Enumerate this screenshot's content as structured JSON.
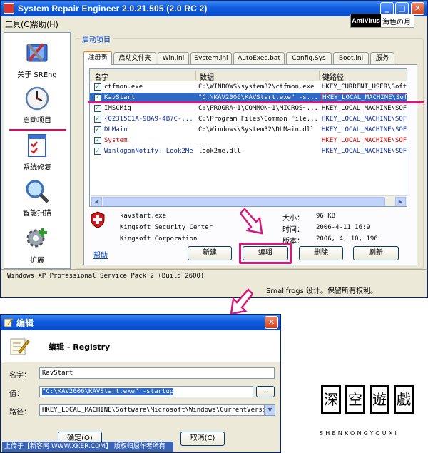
{
  "main_window": {
    "title": "System Repair Engineer 2.0.21.505 (2.0 RC 2)",
    "menu": [
      "工具(C)",
      "帮助(H)"
    ],
    "watermark": {
      "badge": "AntiVirus",
      "text": "海色の月"
    },
    "sidebar": [
      {
        "label": "关于 SREng",
        "icon": "tools-icon"
      },
      {
        "label": "启动项目",
        "icon": "clock-icon"
      },
      {
        "label": "系统修复",
        "icon": "checklist-icon"
      },
      {
        "label": "智能扫描",
        "icon": "magnifier-icon"
      },
      {
        "label": "扩展",
        "icon": "gear-plus-icon"
      }
    ],
    "group_title": "启动项目",
    "tabs": [
      "注册表",
      "启动文件夹",
      "Win.ini",
      "System.ini",
      "AutoExec.bat",
      "Config.Sys",
      "Boot.ini",
      "服务"
    ],
    "list": {
      "headers": [
        "名字",
        "数据",
        "键路径"
      ],
      "rows": [
        {
          "name": "ctfmon.exe",
          "data": "C:\\WINDOWS\\system32\\ctfmon.exe",
          "path": "HKEY_CURRENT_USER\\Soft",
          "color": "#000000"
        },
        {
          "name": "KavStart",
          "data": "\"C:\\KAV2006\\KAVStart.exe\" -s...",
          "path": "HKEY_LOCAL_MACHINE\\Sof",
          "color": "#ffffff"
        },
        {
          "name": "IMSCMig",
          "data": "C:\\PROGRA~1\\COMMON~1\\MICROS~...",
          "path": "HKEY_LOCAL_MACHINE\\SOF",
          "color": "#000000"
        },
        {
          "name": "{02315C1A-9BA9-4B7C-...",
          "data": "C:\\Program Files\\Common File...",
          "path": "HKEY_LOCAL_MACHINE\\SOF",
          "color": "#0a2a9e"
        },
        {
          "name": "DLMain",
          "data": "C:\\Windows\\System32\\DLMain.dll",
          "path": "HKEY_LOCAL_MACHINE\\SOF",
          "color": "#0a2a9e"
        },
        {
          "name": "System",
          "data": "",
          "path": "HKEY_LOCAL_MACHINE\\SOF",
          "color": "#d40000"
        },
        {
          "name": "WinlogonNotify: Look2Me",
          "data": "look2me.dll",
          "path": "HKEY_LOCAL_MACHINE\\SOF",
          "color": "#0a2a9e"
        }
      ]
    },
    "details": {
      "file": "kavstart.exe",
      "description": "Kingsoft Security Center",
      "company": "Kingsoft Corporation",
      "size_label": "大小：",
      "size": "96 KB",
      "time_label": "时间：",
      "time": "2006-4-11 16:9",
      "version_label": "版本：",
      "version": "2006, 4, 10, 196"
    },
    "help_link": "帮助",
    "buttons": {
      "new": "新建",
      "edit": "编辑",
      "delete": "删除",
      "refresh": "刷新"
    },
    "status": "Windows XP Professional Service Pack 2 (Build 2600)",
    "credit": "Smallfrogs 设计。保留所有权利。"
  },
  "edit_dialog": {
    "title": "编辑",
    "header": "编辑 - Registry",
    "name_label": "名字：",
    "name_value": "KavStart",
    "value_label": "值：",
    "value_value": "\"C:\\KAV2006\\KAVStart.exe\" -startup",
    "browse": "...",
    "path_label": "路径：",
    "path_value": "HKEY_LOCAL_MACHINE\\Software\\Microsoft\\Windows\\CurrentVersion\\",
    "ok": "确定(O)",
    "cancel": "取消(C)",
    "footer": "上传于【新客网 WWW.XKER.COM】 版权归原作者所有"
  },
  "brand": {
    "glyphs": [
      "深",
      "空",
      "遊",
      "戲"
    ],
    "subtitle": "SHENKONGYOUXI"
  },
  "colors": {
    "accent_pink": "#d6197b",
    "selection": "#316ac5",
    "title_blue": "#0a4bc8"
  }
}
